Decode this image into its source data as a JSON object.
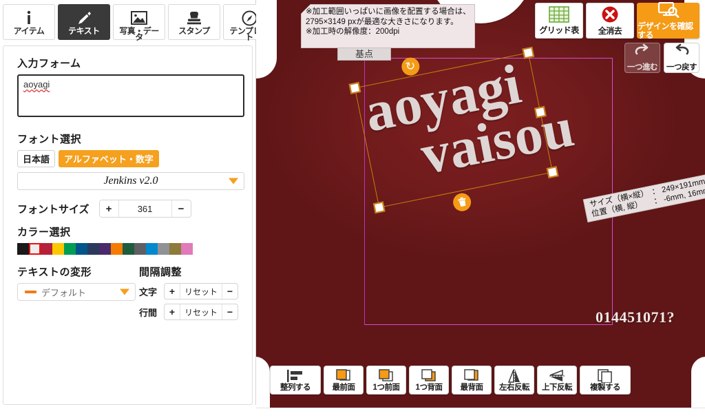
{
  "tabs": [
    {
      "label": "アイテム",
      "icon": "info-icon",
      "active": false
    },
    {
      "label": "テキスト",
      "icon": "pen-icon",
      "active": true
    },
    {
      "label": "写真・デー",
      "label2": "タ",
      "icon": "photo-icon",
      "active": false
    },
    {
      "label": "スタンプ",
      "icon": "stamp-icon",
      "active": false
    },
    {
      "label": "テンプレー",
      "label2": "ト",
      "icon": "template-icon",
      "active": false
    }
  ],
  "form": {
    "input_label": "入力フォーム",
    "input_value": "aoyagi",
    "input_placeholder": "",
    "font_label": "フォント選択",
    "lang_japanese": "日本語",
    "lang_alphabet": "アルファベット・数字",
    "font_selected": "Jenkins v2.0",
    "fontsize_label": "フォントサイズ",
    "fontsize_value": "361",
    "plus": "+",
    "minus": "−",
    "color_label": "カラー選択",
    "swatches": [
      "#1a1a1a",
      "#eeeeee",
      "#b5213a",
      "#fcc800",
      "#009e52",
      "#00558c",
      "#2b3a5c",
      "#4a2a6b",
      "#f57c00",
      "#1f5c3d",
      "#5e6063",
      "#0089cf",
      "#8f9396",
      "#8c7b3a",
      "#e07ab8"
    ],
    "selected_swatch_index": 1,
    "transform_label": "テキストの変形",
    "transform_value": "デフォルト",
    "spacing_label": "間隔調整",
    "spacing_char_label": "文字",
    "spacing_line_label": "行間",
    "reset_label": "リセット"
  },
  "canvas": {
    "notice": "※加工範囲いっぱいに画像を配置する場合は、\n2795×3149 pxが最適な大きさになります。\n※加工時の解像度：200dpi",
    "origin_chip": "基点",
    "design_text_line1": "aoyagi",
    "design_text_line2": "vaisou",
    "design_number": "014451071?",
    "size_tip": {
      "size_key": "サイズ（横×縦）",
      "size_value": "： 249×191mm",
      "pos_key": "位置（横, 縦）",
      "pos_value": "： -6mm, 16mm"
    }
  },
  "top_tools": [
    {
      "label": "グリッド表",
      "icon": "grid-icon",
      "accent": false
    },
    {
      "label": "全消去",
      "icon": "delete-all-icon",
      "accent": false
    },
    {
      "label": "デザインを確認する",
      "icon": "preview-icon",
      "accent": true
    }
  ],
  "undo_tools": [
    {
      "label": "一つ進む",
      "icon": "redo-icon",
      "enabled": false
    },
    {
      "label": "一つ戻す",
      "icon": "undo-icon",
      "enabled": true
    }
  ],
  "bottom_tools": [
    {
      "label": "整列する",
      "icon": "align-icon"
    },
    {
      "label": "最前面",
      "icon": "bring-to-front-icon"
    },
    {
      "label": "1つ前面",
      "icon": "bring-forward-icon"
    },
    {
      "label": "1つ背面",
      "icon": "send-backward-icon"
    },
    {
      "label": "最背面",
      "icon": "send-to-back-icon"
    },
    {
      "label": "左右反転",
      "icon": "flip-horizontal-icon"
    },
    {
      "label": "上下反転",
      "icon": "flip-vertical-icon"
    },
    {
      "label": "複製する",
      "icon": "duplicate-icon"
    }
  ],
  "colors": {
    "accent_orange": "#f59b16",
    "shirt_maroon": "#701b1c",
    "print_frame_magenta": "#d14fd1",
    "selection_orange": "#c87f10"
  }
}
